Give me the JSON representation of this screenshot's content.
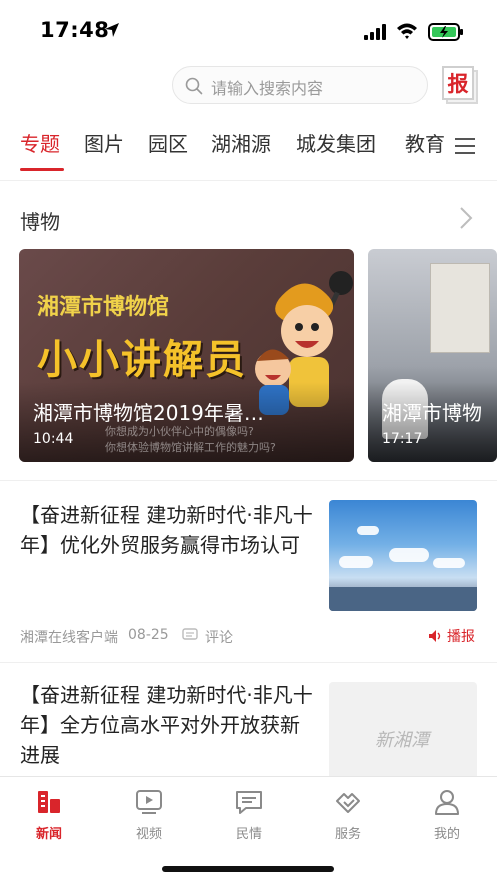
{
  "status_bar": {
    "time": "17:48"
  },
  "header": {
    "search_placeholder": "请输入搜索内容",
    "paper_label": "报"
  },
  "tabs": [
    {
      "label": "专题",
      "active": true
    },
    {
      "label": "图片"
    },
    {
      "label": "园区"
    },
    {
      "label": "湖湘源"
    },
    {
      "label": "城发集团"
    },
    {
      "label": "教育"
    }
  ],
  "section": {
    "title": "博物"
  },
  "videos": [
    {
      "title": "湘潭市博物馆2019年暑…",
      "duration": "10:44",
      "image_text": {
        "museum": "湘潭市博物馆",
        "banner": "小小讲解员",
        "line1": "你想成为小伙伴心中的偶像吗?",
        "line2": "你想体验博物馆讲解工作的魅力吗?"
      }
    },
    {
      "title": "湘潭市博物",
      "duration": "17:17"
    }
  ],
  "news": [
    {
      "title": "【奋进新征程 建功新时代·非凡十年】优化外贸服务赢得市场认可",
      "source": "湘潭在线客户端",
      "date": "08-25",
      "comment_label": "评论",
      "broadcast_label": "播报"
    },
    {
      "title": "【奋进新征程 建功新时代·非凡十年】全方位高水平对外开放获新进展",
      "thumb_watermark": "新湘潭"
    }
  ],
  "tabbar": [
    {
      "label": "新闻",
      "icon": "news-icon",
      "active": true
    },
    {
      "label": "视频",
      "icon": "video-icon"
    },
    {
      "label": "民情",
      "icon": "chat-icon"
    },
    {
      "label": "服务",
      "icon": "service-icon"
    },
    {
      "label": "我的",
      "icon": "profile-icon"
    }
  ],
  "colors": {
    "accent": "#d9252b"
  }
}
